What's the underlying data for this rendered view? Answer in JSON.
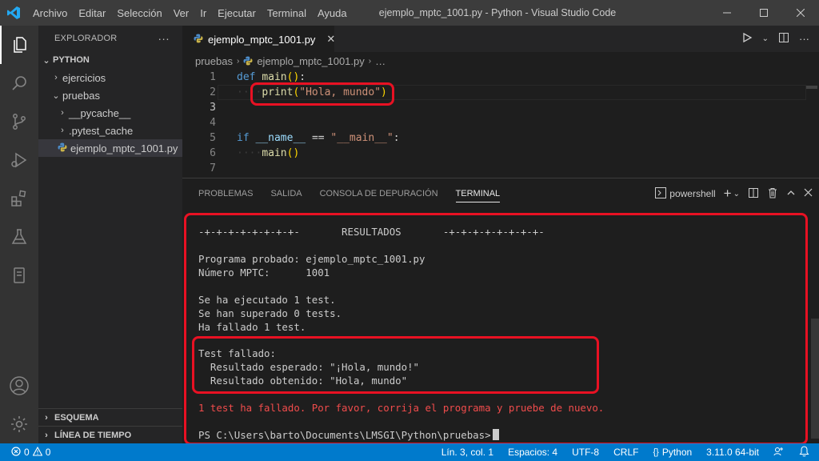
{
  "menu": [
    "Archivo",
    "Editar",
    "Selección",
    "Ver",
    "Ir",
    "Ejecutar",
    "Terminal",
    "Ayuda"
  ],
  "window_title": "ejemplo_mptc_1001.py - Python - Visual Studio Code",
  "sidebar": {
    "header": "EXPLORADOR",
    "more": "···",
    "section": "PYTHON",
    "items": [
      {
        "label": "ejercicios",
        "chevron": "›"
      },
      {
        "label": "pruebas",
        "chevron": "⌄"
      },
      {
        "label": "__pycache__",
        "chevron": "›"
      },
      {
        "label": ".pytest_cache",
        "chevron": "›"
      },
      {
        "label": "ejemplo_mptc_1001.py",
        "chevron": ""
      }
    ],
    "outline": "ESQUEMA",
    "timeline": "LÍNEA DE TIEMPO"
  },
  "editor": {
    "tab_label": "ejemplo_mptc_1001.py",
    "breadcrumb": [
      "pruebas",
      "ejemplo_mptc_1001.py",
      "…"
    ],
    "line_numbers": [
      "1",
      "2",
      "3",
      "4",
      "5",
      "6",
      "7"
    ],
    "code": {
      "def": "def",
      "main": "main",
      "print": "print",
      "hola": "\"Hola, mundo\"",
      "if": "if",
      "name": "__name__",
      "eq": "==",
      "main_str": "\"__main__\"",
      "colon": ":"
    }
  },
  "panel": {
    "tabs": [
      "PROBLEMAS",
      "SALIDA",
      "CONSOLA DE DEPURACIÓN",
      "TERMINAL"
    ],
    "shell": "powershell",
    "terminal_lines": [
      "-+-+-+-+-+-+-+-+-       RESULTADOS       -+-+-+-+-+-+-+-+-",
      "",
      "Programa probado: ejemplo_mptc_1001.py",
      "Número MPTC:      1001",
      "",
      "Se ha ejecutado 1 test.",
      "Se han superado 0 tests.",
      "Ha fallado 1 test.",
      "",
      "Test fallado:",
      "  Resultado esperado: \"¡Hola, mundo!\"",
      "  Resultado obtenido: \"Hola, mundo\"",
      "",
      "1 test ha fallado. Por favor, corrija el programa y pruebe de nuevo.",
      "",
      "PS C:\\Users\\barto\\Documents\\LMSGI\\Python\\pruebas>"
    ]
  },
  "status": {
    "errors": "0",
    "warnings": "0",
    "position": "Lín. 3, col. 1",
    "spaces": "Espacios: 4",
    "encoding": "UTF-8",
    "eol": "CRLF",
    "language": "Python",
    "interpreter": "3.11.0 64-bit"
  },
  "colors": {
    "statusbar": "#007acc",
    "highlight_box": "#e81123",
    "error_text": "#f14c4c"
  }
}
